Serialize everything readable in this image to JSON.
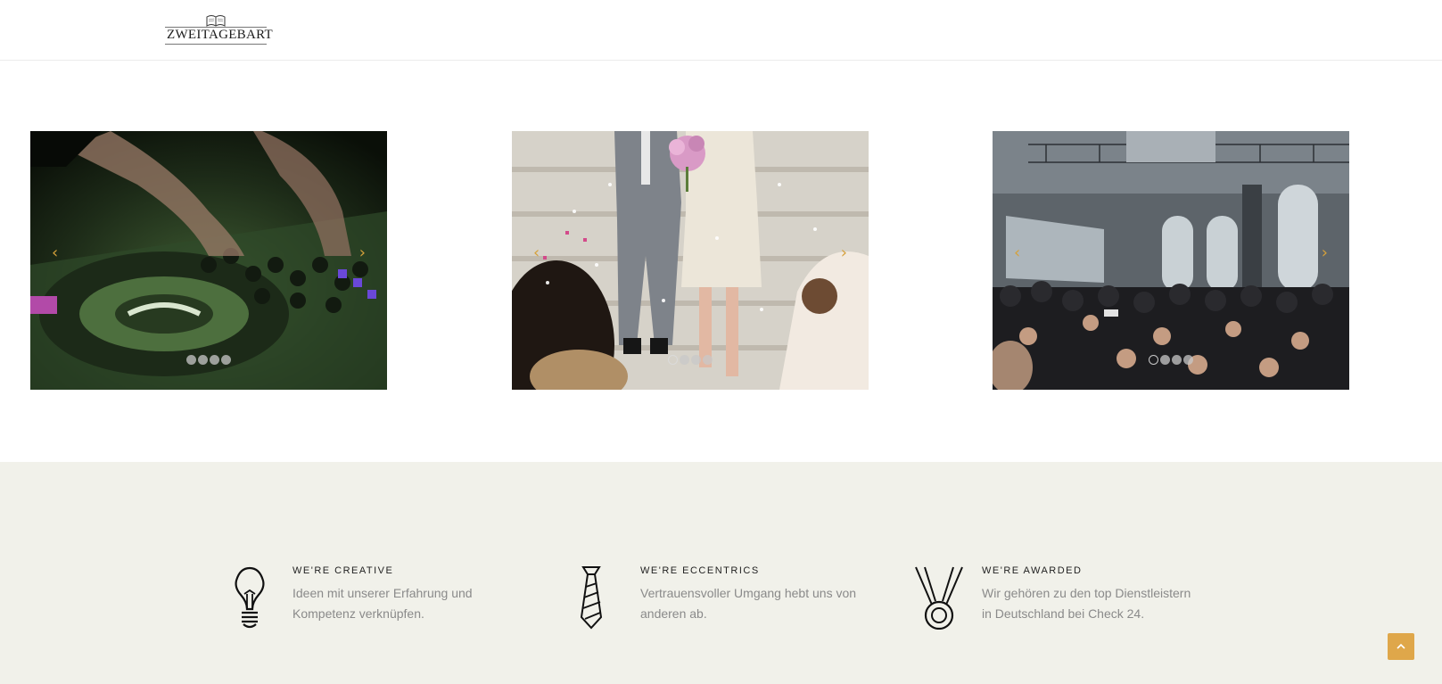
{
  "header": {
    "logo_text": "ZWEITAGEBART",
    "logo_icon": "book-crest-icon"
  },
  "gallery": {
    "slides": [
      {
        "subject": "dj-mixer-photo",
        "prev_label": "‹",
        "next_label": "›",
        "dot_count": 4,
        "active_dot": 0
      },
      {
        "subject": "wedding-couple-photo",
        "prev_label": "‹",
        "next_label": "›",
        "dot_count": 4,
        "active_dot": 0
      },
      {
        "subject": "event-hall-crowd-photo",
        "prev_label": "‹",
        "next_label": "›",
        "dot_count": 4,
        "active_dot": 0
      }
    ]
  },
  "features": [
    {
      "icon": "lightbulb-icon",
      "title": "WE'RE CREATIVE",
      "text": "Ideen mit unserer Erfahrung und Kompetenz verknüpfen."
    },
    {
      "icon": "necktie-icon",
      "title": "WE'RE ECCENTRICS",
      "text": "Vertrauensvoller Umgang hebt uns von anderen ab."
    },
    {
      "icon": "medal-icon",
      "title": "WE'RE AWARDED",
      "text": "Wir gehören zu den top Dienstleistern in Deutschland bei Check 24."
    }
  ],
  "scroll_top": {
    "icon": "chevron-up-icon"
  },
  "colors": {
    "accent": "#dfa74a",
    "features_bg": "#f1f1ea",
    "body_text": "#8a8a8a"
  }
}
